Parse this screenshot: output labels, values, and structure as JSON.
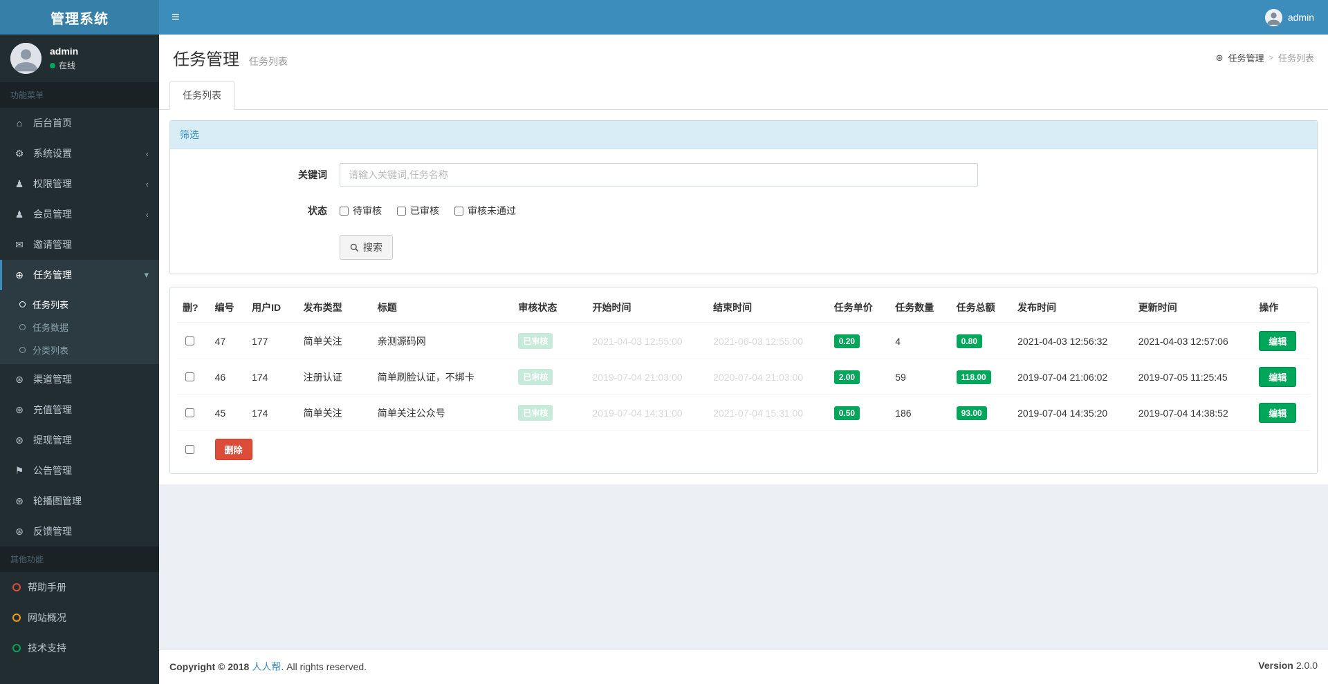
{
  "colors": {
    "primary": "#3c8dbc",
    "brand_dark": "#367fa9",
    "sidebar": "#222d32",
    "success": "#00a65a",
    "danger": "#dd4b39",
    "warning": "#f39c12"
  },
  "icons": {
    "hamburger": "≡",
    "home": "⌂",
    "gears": "⚙",
    "user": "♟",
    "envelope": "✉",
    "globe": "⊕",
    "asterisk": "⊛",
    "flag": "⚑",
    "chevron_left": "‹",
    "chevron_down": "▾",
    "breadcrumb_sep": ">",
    "dashboard": "⊛"
  },
  "topbar": {
    "brand": "管理系统",
    "user": "admin"
  },
  "sidebar": {
    "user": {
      "name": "admin",
      "status": "在线"
    },
    "menu_section": "功能菜单",
    "other_section": "其他功能",
    "items": [
      "后台首页",
      "系统设置",
      "权限管理",
      "会员管理",
      "邀请管理",
      "任务管理",
      "渠道管理",
      "充值管理",
      "提现管理",
      "公告管理",
      "轮播图管理",
      "反馈管理"
    ],
    "task_children": [
      "任务列表",
      "任务数据",
      "分类列表"
    ],
    "other_items": [
      "帮助手册",
      "网站概况",
      "技术支持"
    ]
  },
  "content": {
    "title": "任务管理",
    "subtitle": "任务列表",
    "breadcrumb": [
      "任务管理",
      "任务列表"
    ],
    "tab": "任务列表",
    "filter": {
      "header": "筛选",
      "keyword_label": "关键词",
      "keyword_placeholder": "请输入关键词,任务名称",
      "status_label": "状态",
      "options": [
        "待审核",
        "已审核",
        "审核未通过"
      ],
      "search_label": "搜索"
    },
    "table": {
      "headers": [
        "删?",
        "编号",
        "用户ID",
        "发布类型",
        "标题",
        "审核状态",
        "开始时间",
        "结束时间",
        "任务单价",
        "任务数量",
        "任务总额",
        "发布时间",
        "更新时间",
        "操作"
      ],
      "rows": [
        {
          "id": "47",
          "user_id": "177",
          "type": "简单关注",
          "title": "亲测源码网",
          "status": "已审核",
          "start": "2021-04-03 12:55:00",
          "end": "2021-06-03 12:55:00",
          "price": "0.20",
          "count": "4",
          "total": "0.80",
          "published": "2021-04-03 12:56:32",
          "updated": "2021-04-03 12:57:06"
        },
        {
          "id": "46",
          "user_id": "174",
          "type": "注册认证",
          "title": "简单刷脸认证，不绑卡",
          "status": "已审核",
          "start": "2019-07-04 21:03:00",
          "end": "2020-07-04 21:03:00",
          "price": "2.00",
          "count": "59",
          "total": "118.00",
          "published": "2019-07-04 21:06:02",
          "updated": "2019-07-05 11:25:45"
        },
        {
          "id": "45",
          "user_id": "174",
          "type": "简单关注",
          "title": "简单关注公众号",
          "status": "已审核",
          "start": "2019-07-04 14:31:00",
          "end": "2021-07-04 15:31:00",
          "price": "0.50",
          "count": "186",
          "total": "93.00",
          "published": "2019-07-04 14:35:20",
          "updated": "2019-07-04 14:38:52"
        }
      ],
      "edit_label": "编辑",
      "delete_label": "删除"
    }
  },
  "footer": {
    "copyright": "Copyright © 2018",
    "brand": "人人帮",
    "rest": ". All rights reserved.",
    "version_label": "Version",
    "version": "2.0.0"
  }
}
